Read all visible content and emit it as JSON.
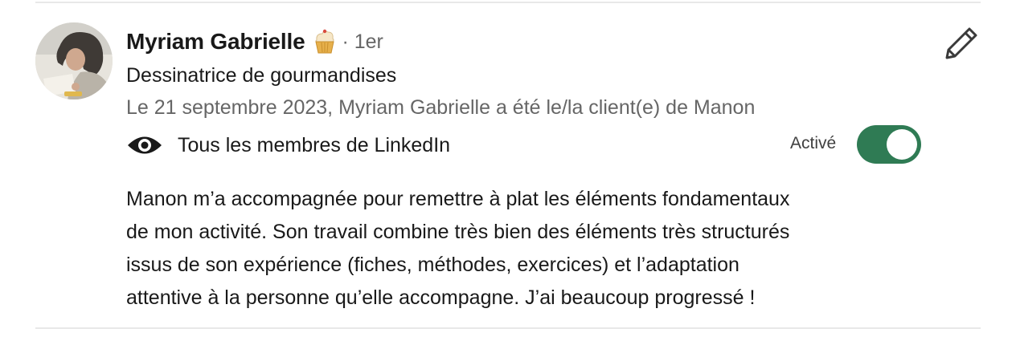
{
  "recommender": {
    "name": "Myriam Gabrielle",
    "badge_icon": "cupcake-icon",
    "connection_degree": "· 1er",
    "headline": "Dessinatrice de gourmandises",
    "relation": "Le 21 septembre 2023, Myriam Gabrielle a été le/la client(e) de Manon"
  },
  "visibility": {
    "icon": "eye-icon",
    "label": "Tous les membres de LinkedIn"
  },
  "toggle": {
    "label": "Activé",
    "state": "on",
    "color": "#2f7b54"
  },
  "actions": {
    "edit_icon": "pencil-icon"
  },
  "recommendation": {
    "lines": [
      "Manon m’a accompagnée pour remettre à plat les éléments fondamentaux",
      "de mon activité. Son travail combine très bien des éléments très structurés",
      "issus de son expérience (fiches, méthodes, exercices) et l’adaptation",
      "attentive à la personne qu’elle accompagne. J’ai beaucoup progressé !"
    ]
  }
}
